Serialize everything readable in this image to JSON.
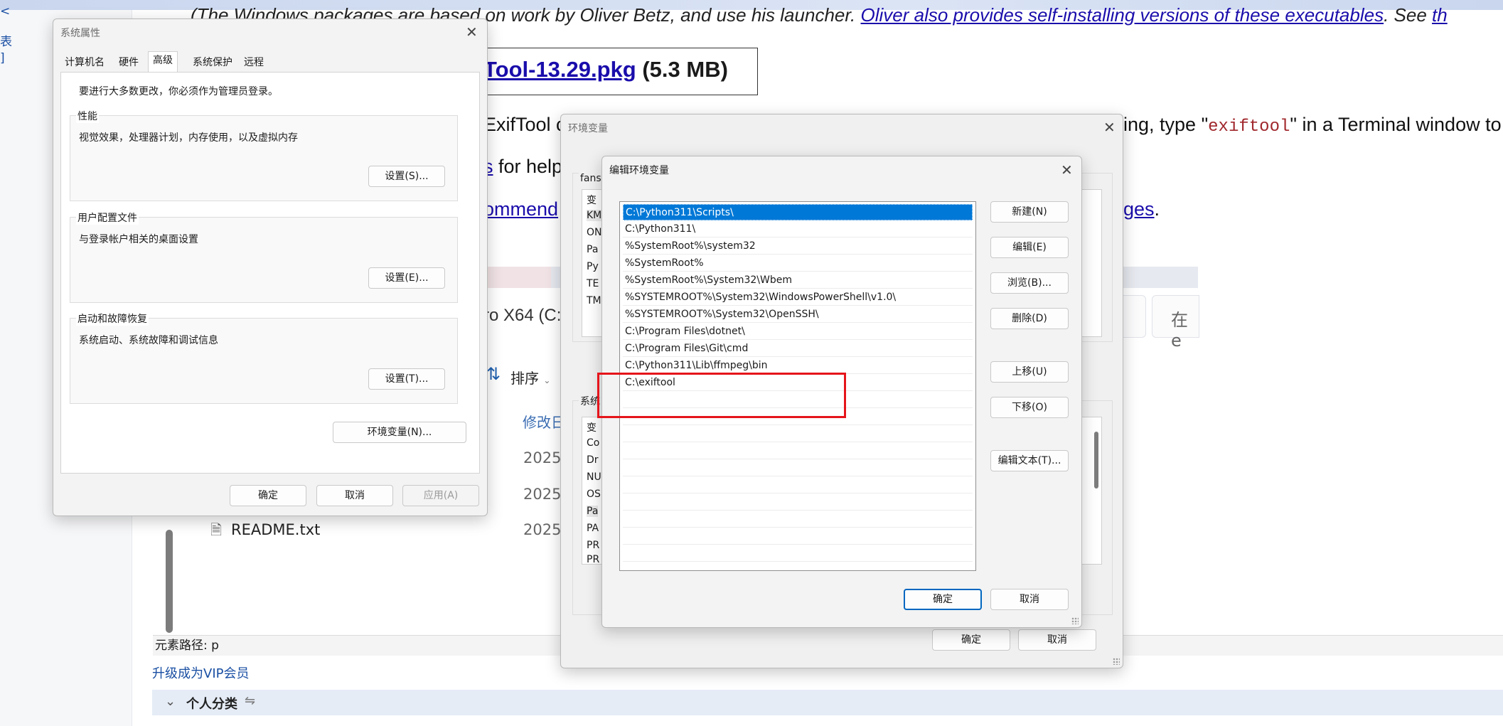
{
  "web_page": {
    "intro_prefix": "(The Windows packages are based on work by Oliver Betz, and use his launcher. ",
    "intro_link": "Oliver also provides self-installing versions of these executables",
    "intro_suffix": ". See ",
    "intro_tail_link": "th",
    "pkg_link": "Tool-13.29.pkg",
    "pkg_size": " (5.3 MB)",
    "line1_prefix": "ExifTool c",
    "line1_suffix_a": "ing, type \"",
    "line1_code": "exiftool",
    "line1_suffix_b": "\" in a Terminal window to",
    "line2_link": "s",
    "line2_text": " for help",
    "line3_link": "ommend",
    "line3_tail_link": "ges",
    "line3_tail": ".",
    "left_sidebar_texts": [
      "<",
      "表",
      "]"
    ]
  },
  "explorer": {
    "drive_label": "ro X64 (C:)",
    "sort_icon": "sort-arrows-icon",
    "sort_label": "排序",
    "modified_header": "修改日",
    "search_prefix": "在 e",
    "rows": [
      {
        "date": "2025/"
      },
      {
        "date": "2025/"
      },
      {
        "icon": "text-file-icon",
        "name": "README.txt",
        "date": "2025/"
      }
    ]
  },
  "status_bar": {
    "element_path": "元素路径: p"
  },
  "vip_link": "升级成为VIP会员",
  "category_bar": {
    "label": "个人分类",
    "collapse_icon": "double-chevron-down-icon",
    "sort_icon": "swap-icon"
  },
  "system_properties": {
    "title": "系统属性",
    "close_glyph": "✕",
    "tabs": [
      "计算机名",
      "硬件",
      "高级",
      "系统保护",
      "远程"
    ],
    "active_tab": "高级",
    "admin_notice": "要进行大多数更改，你必须作为管理员登录。",
    "performance": {
      "title": "性能",
      "desc": "视觉效果，处理器计划，内存使用，以及虚拟内存",
      "button": "设置(S)..."
    },
    "user_profile": {
      "title": "用户配置文件",
      "desc": "与登录帐户相关的桌面设置",
      "button": "设置(E)..."
    },
    "startup": {
      "title": "启动和故障恢复",
      "desc": "系统启动、系统故障和调试信息",
      "button": "设置(T)..."
    },
    "env_button": "环境变量(N)...",
    "ok": "确定",
    "cancel": "取消",
    "apply": "应用(A)"
  },
  "environment_variables": {
    "title": "环境变量",
    "close_glyph": "✕",
    "user_group_label": "fans",
    "user_rows": [
      "变",
      "KM",
      "ON",
      "Pa",
      "Py",
      "TE",
      "TM"
    ],
    "system_group_label": "系统",
    "system_rows": [
      "变",
      "Co",
      "Dr",
      "NU",
      "OS",
      "Pa",
      "PA",
      "PR",
      "PR"
    ],
    "ok": "确定",
    "cancel": "取消"
  },
  "edit_environment_variable": {
    "title": "编辑环境变量",
    "close_glyph": "✕",
    "paths": [
      "C:\\Python311\\Scripts\\",
      "C:\\Python311\\",
      "%SystemRoot%\\system32",
      "%SystemRoot%",
      "%SystemRoot%\\System32\\Wbem",
      "%SYSTEMROOT%\\System32\\WindowsPowerShell\\v1.0\\",
      "%SYSTEMROOT%\\System32\\OpenSSH\\",
      "C:\\Program Files\\dotnet\\",
      "C:\\Program Files\\Git\\cmd",
      "C:\\Python311\\Lib\\ffmpeg\\bin",
      "C:\\exiftool"
    ],
    "selected_index": 0,
    "highlight_color": "#e5151b",
    "buttons": {
      "new": "新建(N)",
      "edit": "编辑(E)",
      "browse": "浏览(B)...",
      "delete": "删除(D)",
      "move_up": "上移(U)",
      "move_down": "下移(O)",
      "edit_text": "编辑文本(T)..."
    },
    "ok": "确定",
    "cancel": "取消"
  }
}
